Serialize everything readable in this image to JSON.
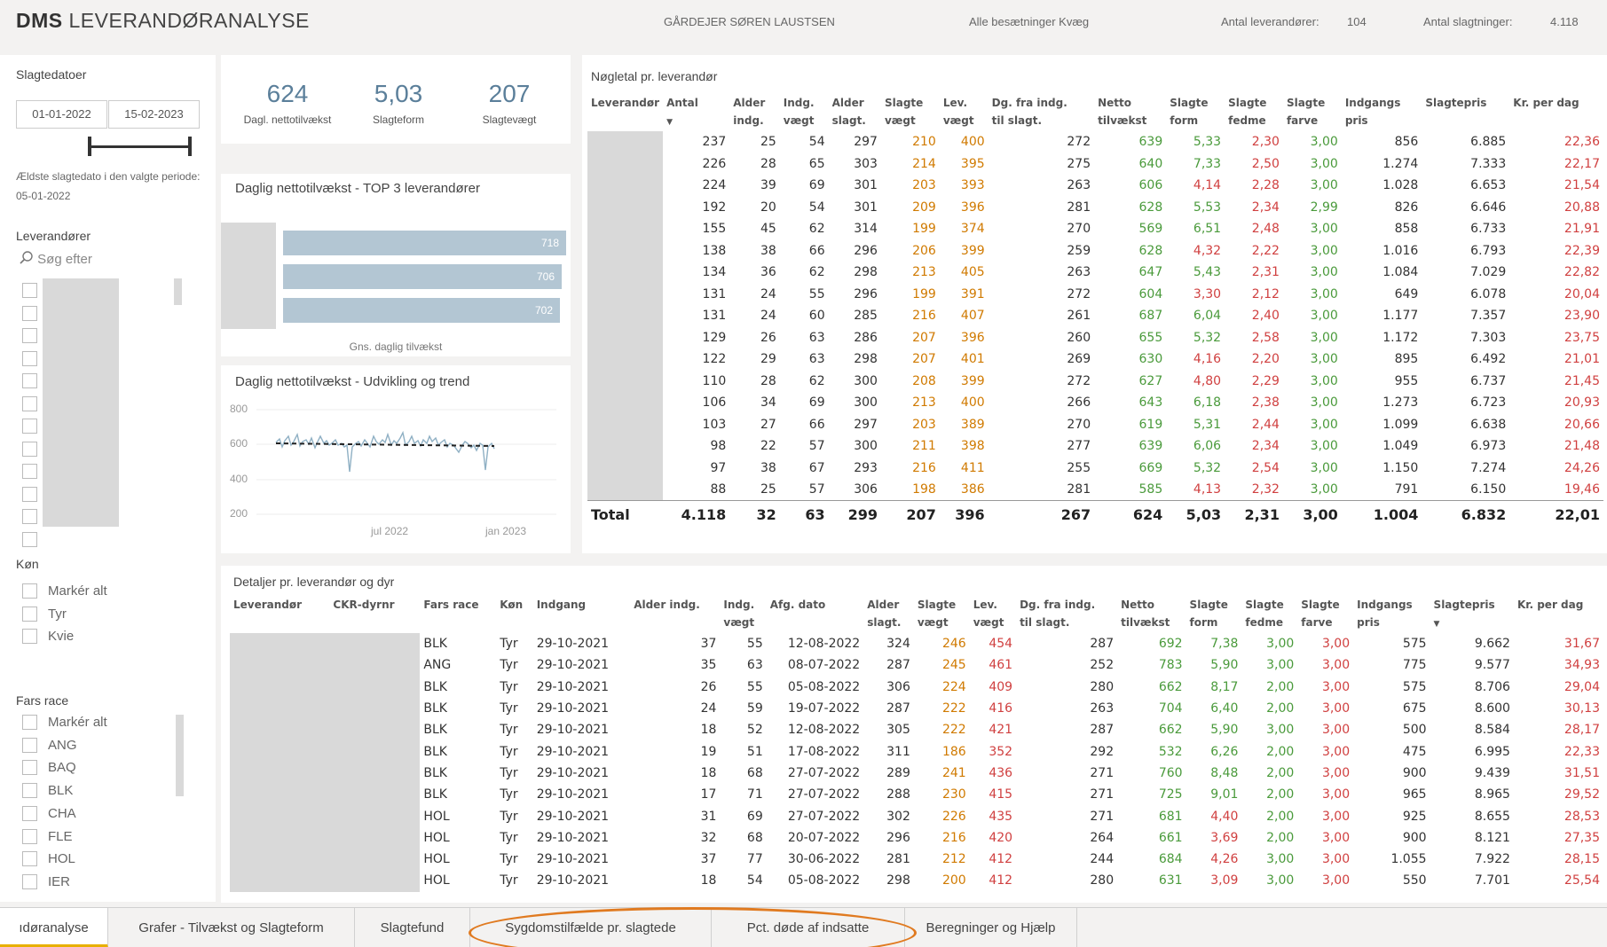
{
  "header": {
    "title_bold": "DMS",
    "title_rest": " LEVERANDØRANALYSE",
    "owner": "GÅRDEJER SØREN LAUSTSEN",
    "filter": "Alle besætninger Kvæg",
    "suppliers_label": "Antal leverandører:",
    "suppliers_value": "104",
    "slaughter_label": "Antal slagtninger:",
    "slaughter_value": "4.118"
  },
  "sidebar": {
    "dates_label": "Slagtedatoer",
    "date_from": "01-01-2022",
    "date_to": "15-02-2023",
    "oldest_text": "Ældste slagtedato i den valgte periode: 05-01-2022",
    "suppliers_label": "Leverandører",
    "search_placeholder": "Søg efter",
    "gender_label": "Køn",
    "gender_items": [
      "Markér alt",
      "Tyr",
      "Kvie"
    ],
    "race_label": "Fars race",
    "race_items": [
      "Markér alt",
      "ANG",
      "BAQ",
      "BLK",
      "CHA",
      "FLE",
      "HOL",
      "IER"
    ]
  },
  "kpis": [
    {
      "value": "624",
      "label": "Dagl. nettotilvækst"
    },
    {
      "value": "5,03",
      "label": "Slagteform"
    },
    {
      "value": "207",
      "label": "Slagtevægt"
    }
  ],
  "top3": {
    "title": "Daglig nettotilvækst - TOP 3 leverandører",
    "values": [
      718,
      706,
      702
    ],
    "labels": [
      "718",
      "706",
      "702"
    ],
    "xlabel": "Gns. daglig tilvækst"
  },
  "trend": {
    "title": "Daglig nettotilvækst - Udvikling og trend",
    "yticks": [
      "800",
      "600",
      "400",
      "200"
    ],
    "xticks": [
      "jul 2022",
      "jan 2023"
    ]
  },
  "keytable": {
    "title": "Nøgletal pr. leverandør",
    "headers": [
      [
        "Leverandør"
      ],
      [
        "Antal"
      ],
      [
        "Alder",
        "indg."
      ],
      [
        "Indg.",
        "vægt"
      ],
      [
        "Alder",
        "slagt."
      ],
      [
        "Slagte",
        "vægt"
      ],
      [
        "Lev.",
        "vægt"
      ],
      [
        "Dg. fra indg.",
        "til slagt."
      ],
      [
        "Netto",
        "tilvækst"
      ],
      [
        "Slagte",
        "form"
      ],
      [
        "Slagte",
        "fedme"
      ],
      [
        "Slagte",
        "farve"
      ],
      [
        "Indgangs",
        "pris"
      ],
      [
        "Slagtepris"
      ],
      [
        "Kr. per dag"
      ]
    ],
    "rows": [
      [
        "237",
        "25",
        "54",
        "297",
        "210",
        "400",
        "272",
        "639",
        "5,33",
        "2,30",
        "3,00",
        "856",
        "6.885",
        "22,36"
      ],
      [
        "226",
        "28",
        "65",
        "303",
        "214",
        "395",
        "275",
        "640",
        "7,33",
        "2,50",
        "3,00",
        "1.274",
        "7.333",
        "22,17"
      ],
      [
        "224",
        "39",
        "69",
        "301",
        "203",
        "393",
        "263",
        "606",
        "4,14",
        "2,28",
        "3,00",
        "1.028",
        "6.653",
        "21,54"
      ],
      [
        "192",
        "20",
        "54",
        "301",
        "209",
        "396",
        "281",
        "628",
        "5,53",
        "2,34",
        "2,99",
        "826",
        "6.646",
        "20,88"
      ],
      [
        "155",
        "45",
        "62",
        "314",
        "199",
        "374",
        "270",
        "569",
        "6,51",
        "2,48",
        "3,00",
        "858",
        "6.733",
        "21,91"
      ],
      [
        "138",
        "38",
        "66",
        "296",
        "206",
        "399",
        "259",
        "628",
        "4,32",
        "2,22",
        "3,00",
        "1.016",
        "6.793",
        "22,39"
      ],
      [
        "134",
        "36",
        "62",
        "298",
        "213",
        "405",
        "263",
        "647",
        "5,43",
        "2,31",
        "3,00",
        "1.084",
        "7.029",
        "22,82"
      ],
      [
        "131",
        "24",
        "55",
        "296",
        "199",
        "391",
        "272",
        "604",
        "3,30",
        "2,12",
        "3,00",
        "649",
        "6.078",
        "20,04"
      ],
      [
        "131",
        "24",
        "60",
        "285",
        "216",
        "407",
        "261",
        "687",
        "6,04",
        "2,40",
        "3,00",
        "1.177",
        "7.357",
        "23,90"
      ],
      [
        "129",
        "26",
        "63",
        "286",
        "207",
        "396",
        "260",
        "655",
        "5,32",
        "2,58",
        "3,00",
        "1.172",
        "7.303",
        "23,75"
      ],
      [
        "122",
        "29",
        "63",
        "298",
        "207",
        "401",
        "269",
        "630",
        "4,16",
        "2,20",
        "3,00",
        "895",
        "6.492",
        "21,01"
      ],
      [
        "110",
        "28",
        "62",
        "300",
        "208",
        "399",
        "272",
        "627",
        "4,80",
        "2,29",
        "3,00",
        "955",
        "6.737",
        "21,45"
      ],
      [
        "106",
        "34",
        "69",
        "300",
        "213",
        "400",
        "266",
        "643",
        "6,18",
        "2,38",
        "3,00",
        "1.273",
        "6.723",
        "20,93"
      ],
      [
        "103",
        "27",
        "66",
        "297",
        "203",
        "389",
        "270",
        "619",
        "5,31",
        "2,44",
        "3,00",
        "1.099",
        "6.638",
        "20,66"
      ],
      [
        "98",
        "22",
        "57",
        "300",
        "211",
        "398",
        "277",
        "639",
        "6,06",
        "2,34",
        "3,00",
        "1.049",
        "6.973",
        "21,48"
      ],
      [
        "97",
        "38",
        "67",
        "293",
        "216",
        "411",
        "255",
        "669",
        "5,32",
        "2,54",
        "3,00",
        "1.150",
        "7.274",
        "24,26"
      ],
      [
        "88",
        "25",
        "57",
        "306",
        "198",
        "386",
        "281",
        "585",
        "4,13",
        "2,32",
        "3,00",
        "791",
        "6.150",
        "19,46"
      ]
    ],
    "total": [
      "Total",
      "4.118",
      "32",
      "63",
      "299",
      "207",
      "396",
      "267",
      "624",
      "5,03",
      "2,31",
      "3,00",
      "1.004",
      "6.832",
      "22,01"
    ]
  },
  "details": {
    "title": "Detaljer pr. leverandør og dyr",
    "headers": [
      [
        "Leverandør"
      ],
      [
        "CKR-dyrnr"
      ],
      [
        "Fars race"
      ],
      [
        "Køn"
      ],
      [
        "Indgang"
      ],
      [
        "Alder indg."
      ],
      [
        "Indg.",
        "vægt"
      ],
      [
        "Afg. dato"
      ],
      [
        "Alder",
        "slagt."
      ],
      [
        "Slagte",
        "vægt"
      ],
      [
        "Lev.",
        "vægt"
      ],
      [
        "Dg. fra indg.",
        "til slagt."
      ],
      [
        "Netto",
        "tilvækst"
      ],
      [
        "Slagte",
        "form"
      ],
      [
        "Slagte",
        "fedme"
      ],
      [
        "Slagte",
        "farve"
      ],
      [
        "Indgangs",
        "pris"
      ],
      [
        "Slagtepris"
      ],
      [
        "Kr. per dag"
      ]
    ],
    "rows": [
      [
        "BLK",
        "Tyr",
        "29-10-2021",
        "37",
        "55",
        "12-08-2022",
        "324",
        "246",
        "454",
        "287",
        "692",
        "7,38",
        "3,00",
        "3,00",
        "575",
        "9.662",
        "31,67"
      ],
      [
        "ANG",
        "Tyr",
        "29-10-2021",
        "35",
        "63",
        "08-07-2022",
        "287",
        "245",
        "461",
        "252",
        "783",
        "5,90",
        "3,00",
        "3,00",
        "775",
        "9.577",
        "34,93"
      ],
      [
        "BLK",
        "Tyr",
        "29-10-2021",
        "26",
        "55",
        "05-08-2022",
        "306",
        "224",
        "409",
        "280",
        "662",
        "8,17",
        "2,00",
        "3,00",
        "575",
        "8.706",
        "29,04"
      ],
      [
        "BLK",
        "Tyr",
        "29-10-2021",
        "24",
        "59",
        "19-07-2022",
        "287",
        "222",
        "416",
        "263",
        "704",
        "6,40",
        "2,00",
        "3,00",
        "675",
        "8.600",
        "30,13"
      ],
      [
        "BLK",
        "Tyr",
        "29-10-2021",
        "18",
        "52",
        "12-08-2022",
        "305",
        "222",
        "421",
        "287",
        "662",
        "5,90",
        "3,00",
        "3,00",
        "500",
        "8.584",
        "28,17"
      ],
      [
        "BLK",
        "Tyr",
        "29-10-2021",
        "19",
        "51",
        "17-08-2022",
        "311",
        "186",
        "352",
        "292",
        "532",
        "6,26",
        "2,00",
        "3,00",
        "475",
        "6.995",
        "22,33"
      ],
      [
        "BLK",
        "Tyr",
        "29-10-2021",
        "18",
        "68",
        "27-07-2022",
        "289",
        "241",
        "436",
        "271",
        "760",
        "8,48",
        "2,00",
        "3,00",
        "900",
        "9.439",
        "31,51"
      ],
      [
        "BLK",
        "Tyr",
        "29-10-2021",
        "17",
        "71",
        "27-07-2022",
        "288",
        "230",
        "415",
        "271",
        "725",
        "9,01",
        "2,00",
        "3,00",
        "965",
        "8.965",
        "29,52"
      ],
      [
        "HOL",
        "Tyr",
        "29-10-2021",
        "31",
        "69",
        "27-07-2022",
        "302",
        "226",
        "435",
        "271",
        "681",
        "4,40",
        "2,00",
        "3,00",
        "925",
        "8.655",
        "28,53"
      ],
      [
        "HOL",
        "Tyr",
        "29-10-2021",
        "32",
        "68",
        "20-07-2022",
        "296",
        "216",
        "420",
        "264",
        "661",
        "3,69",
        "2,00",
        "3,00",
        "900",
        "8.121",
        "27,35"
      ],
      [
        "HOL",
        "Tyr",
        "29-10-2021",
        "37",
        "77",
        "30-06-2022",
        "281",
        "212",
        "412",
        "244",
        "684",
        "4,26",
        "3,00",
        "3,00",
        "1.055",
        "7.922",
        "28,15"
      ],
      [
        "HOL",
        "Tyr",
        "29-10-2021",
        "18",
        "54",
        "05-08-2022",
        "298",
        "200",
        "412",
        "280",
        "631",
        "3,09",
        "3,00",
        "3,00",
        "550",
        "7.701",
        "25,54"
      ]
    ]
  },
  "tabs": [
    "ıdøranalyse",
    "Grafer - Tilvækst og Slagteform",
    "Slagtefund",
    "Sygdomstilfælde pr. slagtede",
    "Pct. døde af indsatte",
    "Beregninger og Hjælp"
  ]
}
